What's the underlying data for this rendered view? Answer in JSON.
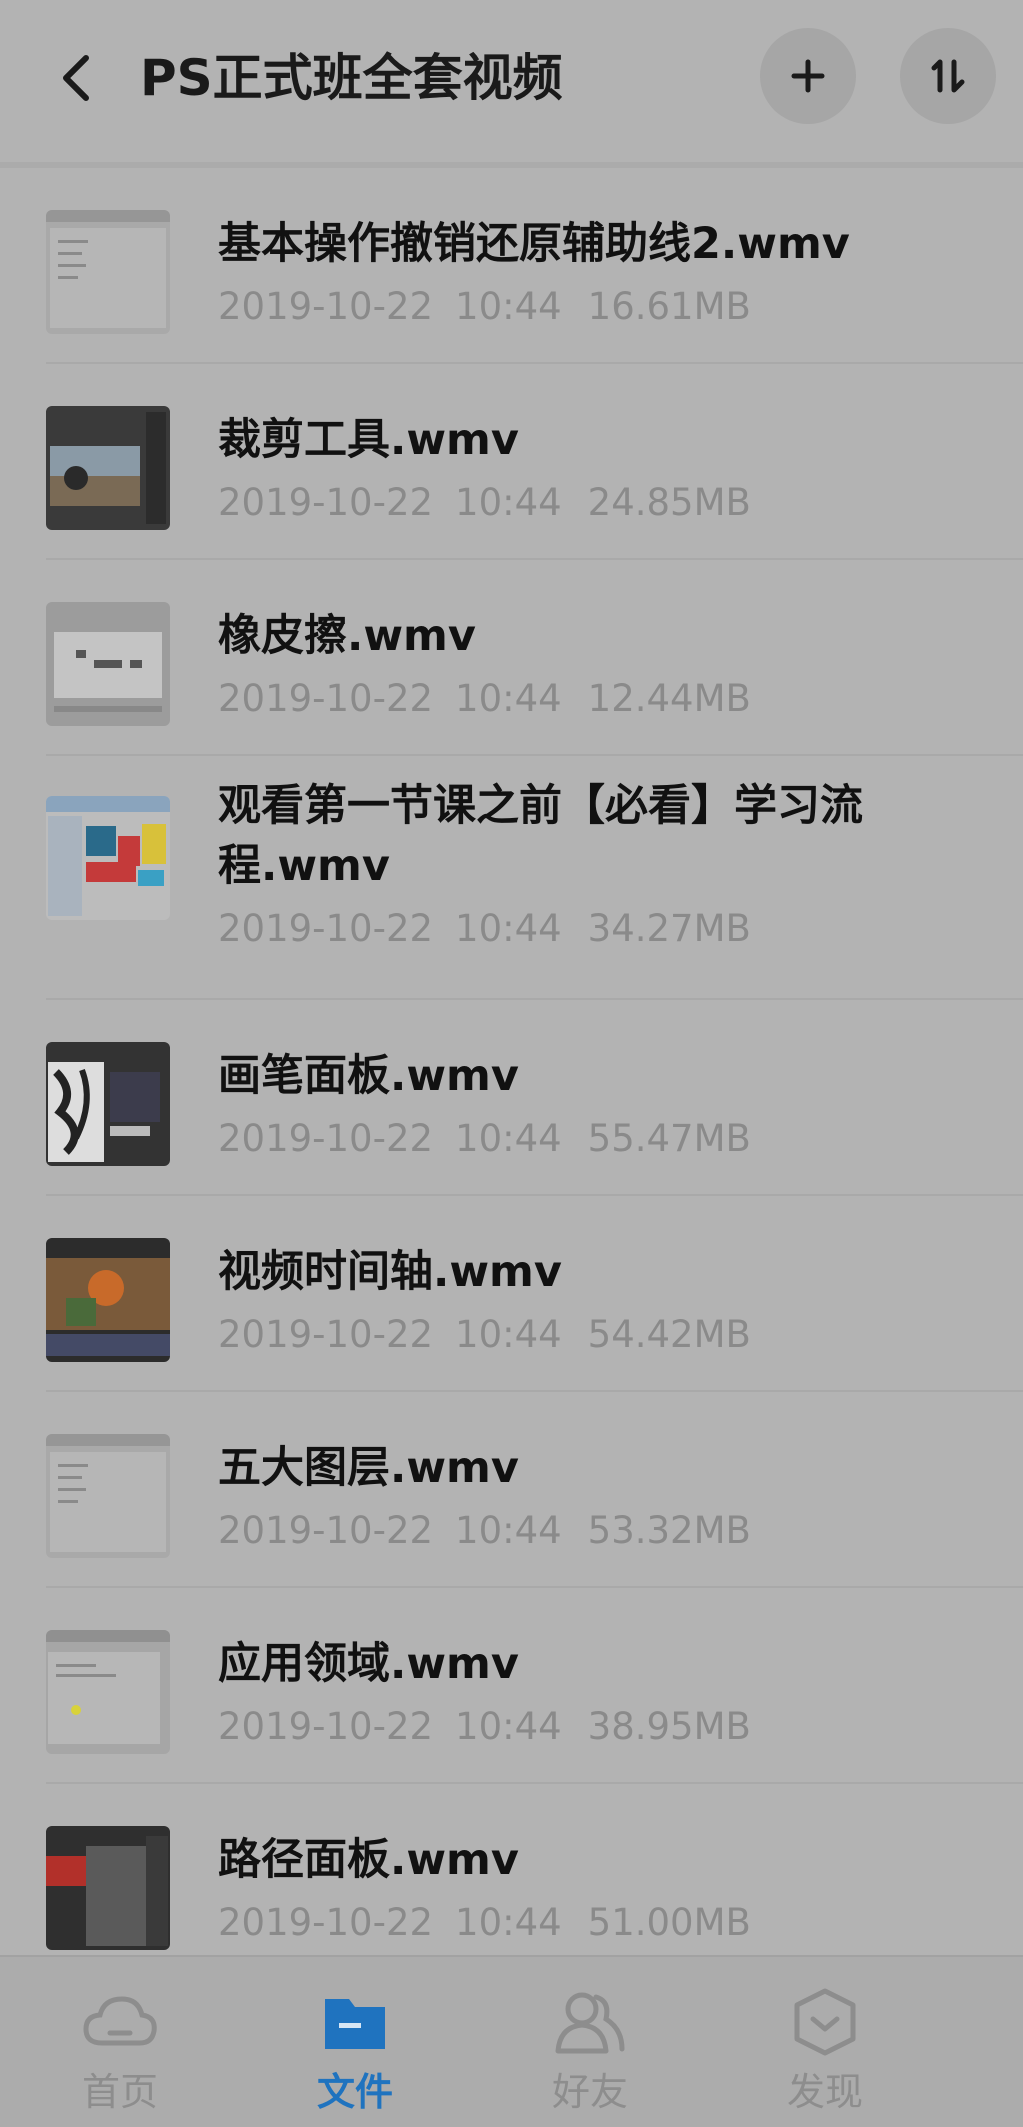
{
  "header": {
    "title": "PS正式班全套视频",
    "back_icon": "back-arrow-icon",
    "add_icon": "plus-icon",
    "sort_icon": "sort-icon"
  },
  "files": [
    {
      "name": "基本操作撤销还原辅助线2.wmv",
      "date": "2019-10-22",
      "time": "10:44",
      "size": "16.61MB",
      "thumb": "light-screenshot"
    },
    {
      "name": "裁剪工具.wmv",
      "date": "2019-10-22",
      "time": "10:44",
      "size": "24.85MB",
      "thumb": "dark-photo"
    },
    {
      "name": "橡皮擦.wmv",
      "date": "2019-10-22",
      "time": "10:44",
      "size": "12.44MB",
      "thumb": "light-slide"
    },
    {
      "name": "观看第一节课之前【必看】学习流程.wmv",
      "date": "2019-10-22",
      "time": "10:44",
      "size": "34.27MB",
      "thumb": "colorful-grid"
    },
    {
      "name": "画笔面板.wmv",
      "date": "2019-10-22",
      "time": "10:44",
      "size": "55.47MB",
      "thumb": "dark-brush"
    },
    {
      "name": "视频时间轴.wmv",
      "date": "2019-10-22",
      "time": "10:44",
      "size": "54.42MB",
      "thumb": "dark-video"
    },
    {
      "name": "五大图层.wmv",
      "date": "2019-10-22",
      "time": "10:44",
      "size": "53.32MB",
      "thumb": "light-screenshot"
    },
    {
      "name": "应用领域.wmv",
      "date": "2019-10-22",
      "time": "10:44",
      "size": "38.95MB",
      "thumb": "light-dot"
    },
    {
      "name": "路径面板.wmv",
      "date": "2019-10-22",
      "time": "10:44",
      "size": "51.00MB",
      "thumb": "dark-red"
    }
  ],
  "tabs": [
    {
      "label": "首页",
      "icon": "cloud-icon",
      "active": false
    },
    {
      "label": "文件",
      "icon": "folder-icon",
      "active": true
    },
    {
      "label": "好友",
      "icon": "friends-icon",
      "active": false
    },
    {
      "label": "发现",
      "icon": "discover-icon",
      "active": false
    }
  ],
  "colors": {
    "accent": "#1f73bf",
    "background": "#b3b3b3"
  }
}
